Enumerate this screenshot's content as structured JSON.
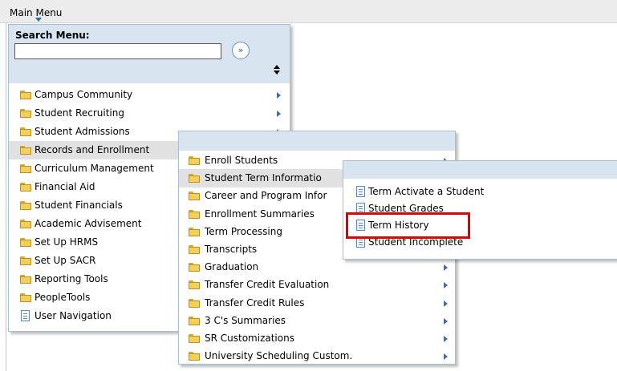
{
  "header": {
    "title": "Main Menu"
  },
  "search": {
    "label": "Search Menu:",
    "value": "",
    "go_glyph": "»"
  },
  "main_menu": [
    {
      "label": "Campus Community",
      "type": "folder",
      "has_children": true
    },
    {
      "label": "Student Recruiting",
      "type": "folder",
      "has_children": true
    },
    {
      "label": "Student Admissions",
      "type": "folder",
      "has_children": true
    },
    {
      "label": "Records and Enrollment",
      "type": "folder",
      "has_children": true
    },
    {
      "label": "Curriculum Management",
      "type": "folder",
      "has_children": false
    },
    {
      "label": "Financial Aid",
      "type": "folder",
      "has_children": false
    },
    {
      "label": "Student Financials",
      "type": "folder",
      "has_children": false
    },
    {
      "label": "Academic Advisement",
      "type": "folder",
      "has_children": false
    },
    {
      "label": "Set Up HRMS",
      "type": "folder",
      "has_children": false
    },
    {
      "label": "Set Up SACR",
      "type": "folder",
      "has_children": false
    },
    {
      "label": "Reporting Tools",
      "type": "folder",
      "has_children": false
    },
    {
      "label": "PeopleTools",
      "type": "folder",
      "has_children": false
    },
    {
      "label": "User Navigation",
      "type": "doc",
      "has_children": false
    }
  ],
  "records_submenu": [
    {
      "label": "Enroll Students",
      "type": "folder",
      "has_children": true
    },
    {
      "label": "Student Term Informatio",
      "type": "folder",
      "has_children": false
    },
    {
      "label": "Career and Program Infor",
      "type": "folder",
      "has_children": false
    },
    {
      "label": "Enrollment Summaries",
      "type": "folder",
      "has_children": false
    },
    {
      "label": "Term Processing",
      "type": "folder",
      "has_children": false
    },
    {
      "label": "Transcripts",
      "type": "folder",
      "has_children": false
    },
    {
      "label": "Graduation",
      "type": "folder",
      "has_children": true
    },
    {
      "label": "Transfer Credit Evaluation",
      "type": "folder",
      "has_children": true
    },
    {
      "label": "Transfer Credit Rules",
      "type": "folder",
      "has_children": true
    },
    {
      "label": "3 C's Summaries",
      "type": "folder",
      "has_children": true
    },
    {
      "label": "SR Customizations",
      "type": "folder",
      "has_children": true
    },
    {
      "label": "University Scheduling Custom.",
      "type": "folder",
      "has_children": true
    }
  ],
  "term_submenu": [
    {
      "label": "Term Activate a Student",
      "type": "doc"
    },
    {
      "label": "Student Grades",
      "type": "doc"
    },
    {
      "label": "Term History",
      "type": "doc"
    },
    {
      "label": "Student Incomplete",
      "type": "doc"
    }
  ],
  "colors": {
    "accent": "#3b6db3",
    "panel": "#d9e4f1",
    "highlight": "#e00000",
    "folder": "#f3cf5b"
  },
  "icons": {
    "folder": "folder-icon",
    "doc": "document-icon",
    "arrow": "chevron-right-icon",
    "go": "go-button-icon",
    "sort": "sort-icon"
  }
}
